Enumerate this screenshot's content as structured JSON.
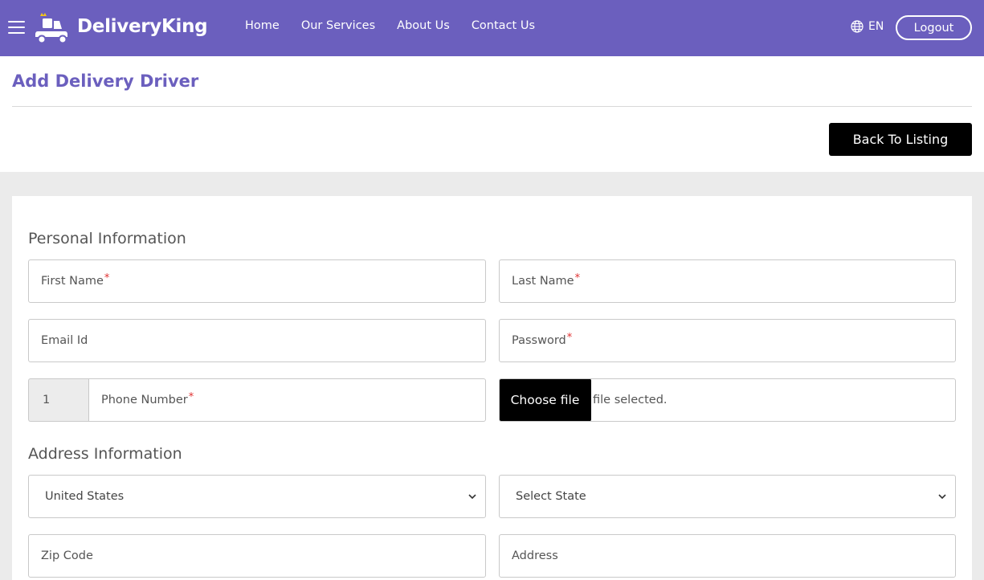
{
  "nav": {
    "brand": "DeliveryKing",
    "links": [
      "Home",
      "Our Services",
      "About Us",
      "Contact Us"
    ],
    "language": "EN",
    "logout_label": "Logout"
  },
  "header": {
    "title": "Add Delivery Driver",
    "back_label": "Back To Listing"
  },
  "form": {
    "personal_title": "Personal Information",
    "first_name": "First Name",
    "last_name": "Last Name",
    "email": "Email Id",
    "password": "Password",
    "phone_code": "1",
    "phone_number": "Phone Number",
    "file_button": "Choose file",
    "file_status": "file selected.",
    "address_title": "Address Information",
    "country_value": "United States",
    "state_placeholder": "Select State",
    "zip": "Zip Code",
    "address": "Address",
    "required_mark": "*"
  },
  "colors": {
    "brand": "#6b5fbe",
    "required": "#e03131",
    "button": "#000000"
  }
}
